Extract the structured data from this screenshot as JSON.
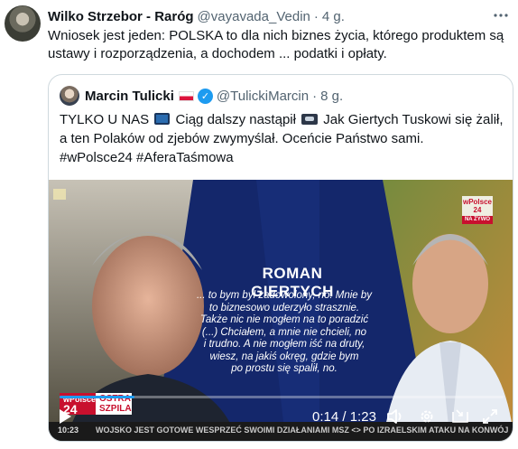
{
  "tweet": {
    "author_name": "Wilko Strzebor - Raróg",
    "handle": "@vayavada_Vedin",
    "separator": "·",
    "time": "4 g.",
    "more_icon": "more-dots-icon",
    "text_line1": "Wniosek jest jeden: POLSKA to dla nich biznes życia, którego produktem są",
    "text_line2": "ustawy i rozporządzenia, a dochodem ... podatki i opłaty."
  },
  "quoted": {
    "author_name": "Marcin Tulicki",
    "handle": "@TulickiMarcin",
    "separator": "·",
    "time": "8 g.",
    "text_part1": "TYLKO U NAS",
    "text_part2": "Ciąg dalszy nastąpił",
    "text_part3": "Jak Giertych Tuskowi się żalił,",
    "text_line2": "a ten Polaków od zjebów zwymyślał. Oceńcie Państwo sami.",
    "text_line3": "#wPolsce24 #AferaTaśmowa"
  },
  "video": {
    "guest_name": "ROMAN GIERTYCH",
    "quote_lines": [
      "... to bym był zadowolony, no. Mnie by",
      "to biznesowo uderzyło strasznie.",
      "Także nic nie mogłem na to poradzić",
      "(...) Chciałem, a mnie nie chcieli, no",
      "i trudno. A nie mogłem iść na druty,",
      "wiesz, na jakiś okręg, gdzie bym",
      "po prostu się spalił, no."
    ],
    "logo_top": "wPolsce",
    "logo_num": "24",
    "na_zywo": "NA ŻYWO",
    "badge_brand": "wPolsce",
    "badge_num": "24",
    "badge_show1": "OSTRA",
    "badge_show2": "SZPILA",
    "ticker_clock": "10:23",
    "ticker_text": "WOJSKO JEST GOTOWE WESPRZEĆ SWOIMI DZIAŁANIAMI MSZ <> PO IZRAELSKIM ATAKU NA KONWÓJ",
    "current_time": "0:14",
    "time_separator": "/",
    "duration": "1:23",
    "progress_fraction": 0.169
  },
  "colors": {
    "text_primary": "#0f1419",
    "text_secondary": "#536471",
    "border": "#cfd9de",
    "verified": "#1d9bf0",
    "brand_red": "#c8102e",
    "studio_blue": "#14276b"
  },
  "icons": [
    "play-icon",
    "volume-icon",
    "settings-gear-icon",
    "pip-icon",
    "fullscreen-icon",
    "verified-badge-icon",
    "poland-flag-icon",
    "tv-emoji-icon",
    "cassette-emoji-icon"
  ]
}
